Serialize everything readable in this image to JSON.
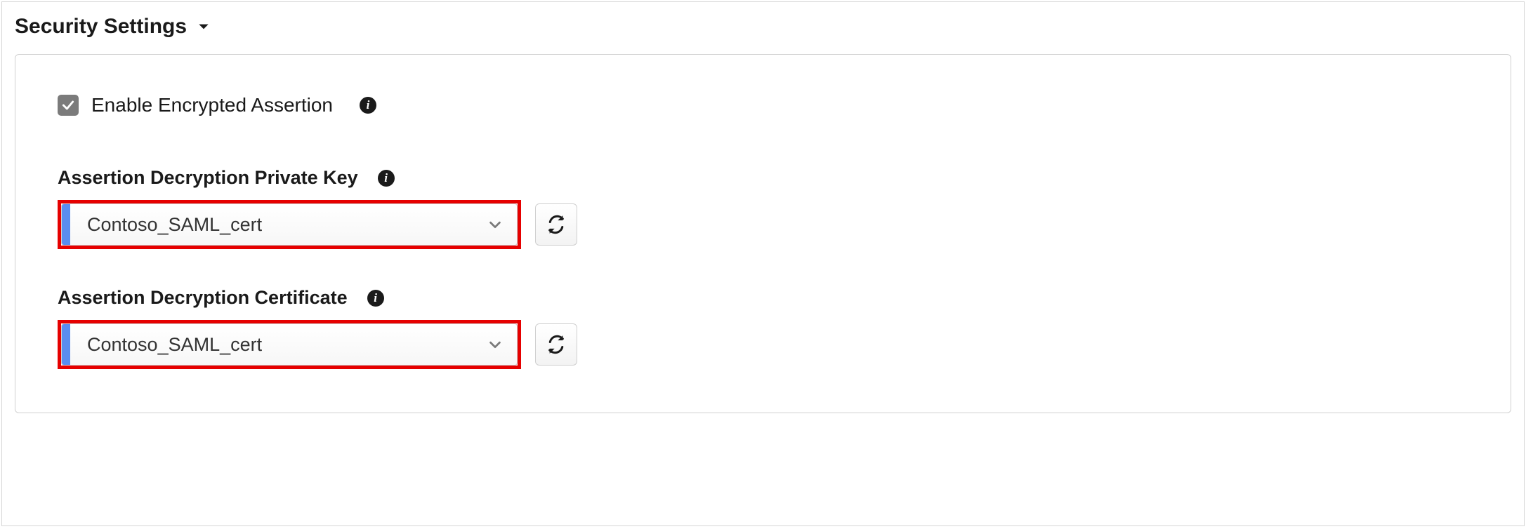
{
  "section": {
    "title": "Security Settings"
  },
  "enable_encrypted_assertion": {
    "label": "Enable Encrypted Assertion",
    "checked": true
  },
  "private_key": {
    "label": "Assertion Decryption Private Key",
    "value": "Contoso_SAML_cert"
  },
  "certificate": {
    "label": "Assertion Decryption Certificate",
    "value": "Contoso_SAML_cert"
  },
  "colors": {
    "highlight": "#e60000",
    "select_accent": "#5a8df0",
    "checkbox_bg": "#7b7b7b"
  }
}
